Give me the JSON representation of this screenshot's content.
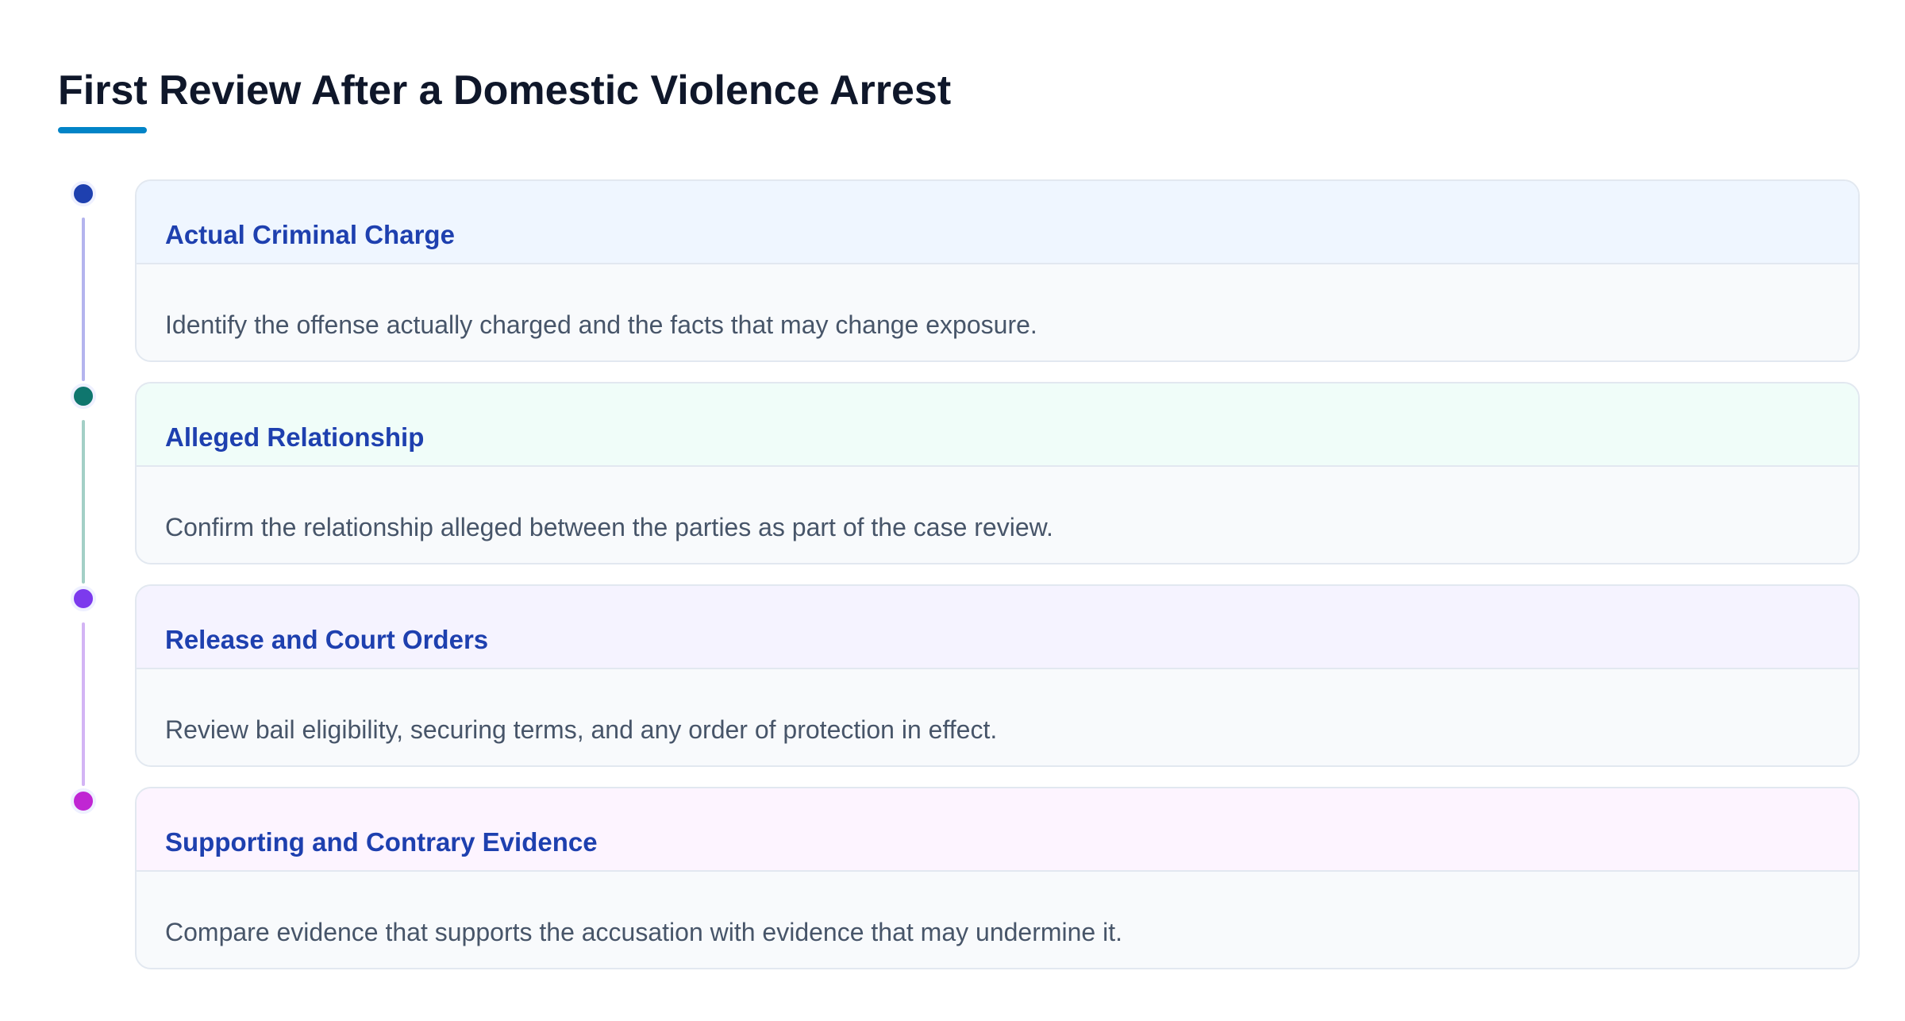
{
  "page": {
    "title": "First Review After a Domestic Violence Arrest",
    "accent_color": "#0284c7"
  },
  "steps": [
    {
      "title": "Actual Criminal Charge",
      "text": "Identify the offense actually charged and the facts that may change exposure.",
      "dot_color": "#1e40af",
      "line_color": "#b4b4ee",
      "header_bg": "#eff6ff"
    },
    {
      "title": "Alleged Relationship",
      "text": "Confirm the relationship alleged between the parties as part of the case review.",
      "dot_color": "#0f766e",
      "line_color": "#a3cfc6",
      "header_bg": "#f0fdf9"
    },
    {
      "title": "Release and Court Orders",
      "text": "Review bail eligibility, securing terms, and any order of protection in effect.",
      "dot_color": "#7c3aed",
      "line_color": "#d3b4f4",
      "header_bg": "#f5f3ff"
    },
    {
      "title": "Supporting and Contrary Evidence",
      "text": "Compare evidence that supports the accusation with evidence that may undermine it.",
      "dot_color": "#c026d3",
      "line_color": "",
      "header_bg": "#fdf4ff"
    }
  ]
}
